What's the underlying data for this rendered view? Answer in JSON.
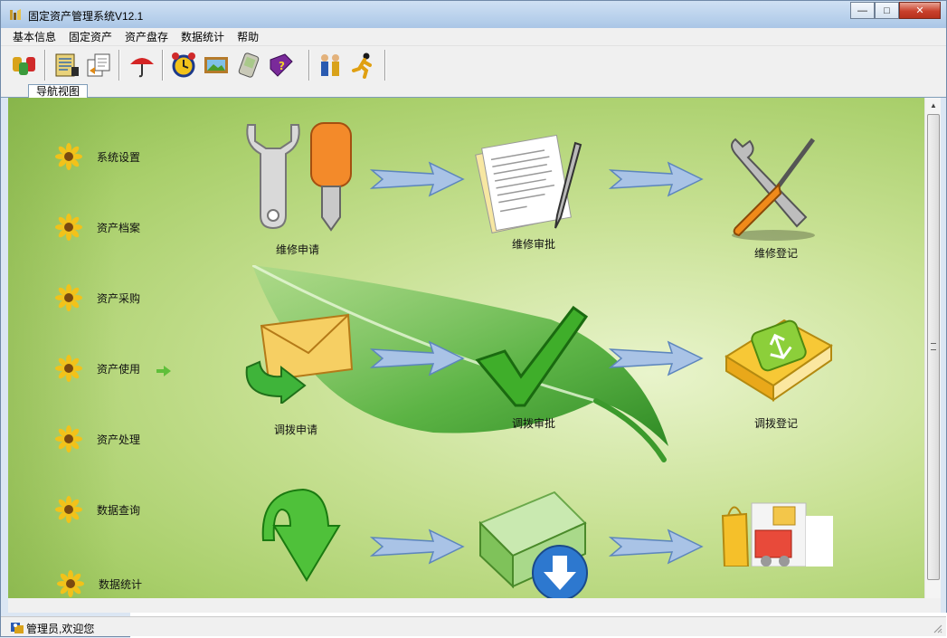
{
  "window": {
    "title": "固定资产管理系统V12.1",
    "buttons": {
      "minimize": "—",
      "maximize": "□",
      "close": "✕"
    }
  },
  "menu": [
    "基本信息",
    "固定资产",
    "资产盘存",
    "数据统计",
    "帮助"
  ],
  "toolbar": {
    "icons": [
      "users-icon",
      "notebook-icon",
      "documents-icon",
      "umbrella-icon",
      "alarm-clock-icon",
      "picture-icon",
      "pda-icon",
      "help-book-icon",
      "people-icon",
      "runner-icon"
    ]
  },
  "tabs": [
    {
      "label": "导航视图"
    }
  ],
  "nav": {
    "items": [
      "系统设置",
      "资产档案",
      "资产采购",
      "资产使用",
      "资产处理",
      "数据查询",
      "数据统计"
    ],
    "active_index": 3
  },
  "flow": {
    "row1": [
      "维修申请",
      "维修审批",
      "维修登记"
    ],
    "row2": [
      "调拨申请",
      "调拨审批",
      "调拨登记"
    ],
    "row3": [
      "",
      "",
      ""
    ]
  },
  "status": {
    "text": "管理员,欢迎您"
  },
  "colors": {
    "accent": "#8cbb4e",
    "titlebar": "#b9d1ec",
    "nav_flower": "#f2c21a"
  }
}
